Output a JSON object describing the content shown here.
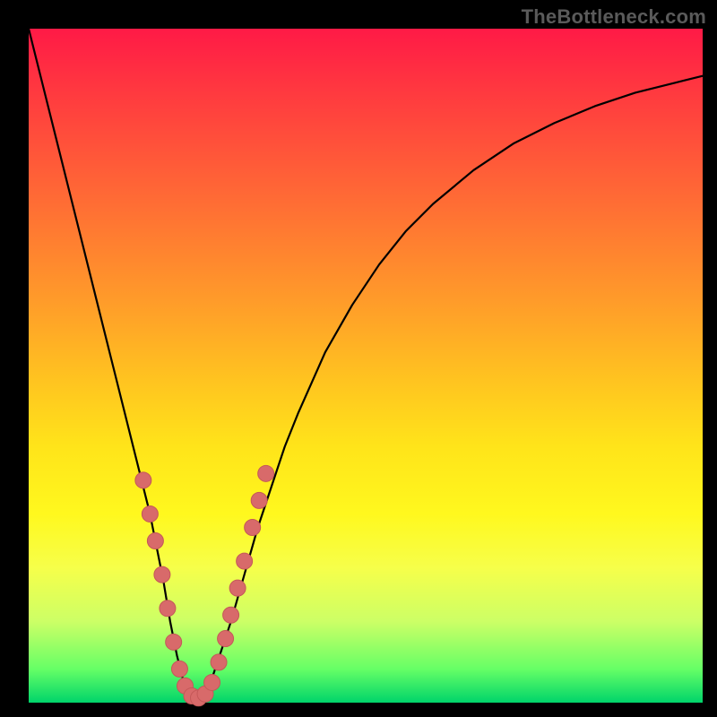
{
  "watermark": "TheBottleneck.com",
  "colors": {
    "curve_stroke": "#000000",
    "marker_fill": "#d86a6a",
    "marker_stroke": "#c45858"
  },
  "chart_data": {
    "type": "line",
    "title": "",
    "xlabel": "",
    "ylabel": "",
    "xlim": [
      0,
      100
    ],
    "ylim": [
      0,
      100
    ],
    "series": [
      {
        "name": "bottleneck-curve",
        "x": [
          0,
          2,
          4,
          6,
          8,
          10,
          12,
          14,
          16,
          18,
          20,
          21,
          22,
          23,
          24,
          25,
          26,
          27,
          28,
          30,
          32,
          34,
          36,
          38,
          40,
          44,
          48,
          52,
          56,
          60,
          66,
          72,
          78,
          84,
          90,
          96,
          100
        ],
        "y": [
          100,
          92,
          84,
          76,
          68,
          60,
          52,
          44,
          36,
          28,
          18,
          12,
          7,
          3,
          1,
          0.5,
          1,
          3,
          6,
          12,
          19,
          26,
          32,
          38,
          43,
          52,
          59,
          65,
          70,
          74,
          79,
          83,
          86,
          88.5,
          90.5,
          92,
          93
        ]
      }
    ],
    "markers": {
      "name": "highlight-points",
      "x": [
        17.0,
        18.0,
        18.8,
        19.8,
        20.6,
        21.5,
        22.4,
        23.2,
        24.2,
        25.2,
        26.2,
        27.2,
        28.2,
        29.2,
        30.0,
        31.0,
        32.0,
        33.2,
        34.2,
        35.2
      ],
      "y": [
        33,
        28,
        24,
        19,
        14,
        9,
        5,
        2.5,
        1,
        0.7,
        1.3,
        3,
        6,
        9.5,
        13,
        17,
        21,
        26,
        30,
        34
      ]
    }
  }
}
